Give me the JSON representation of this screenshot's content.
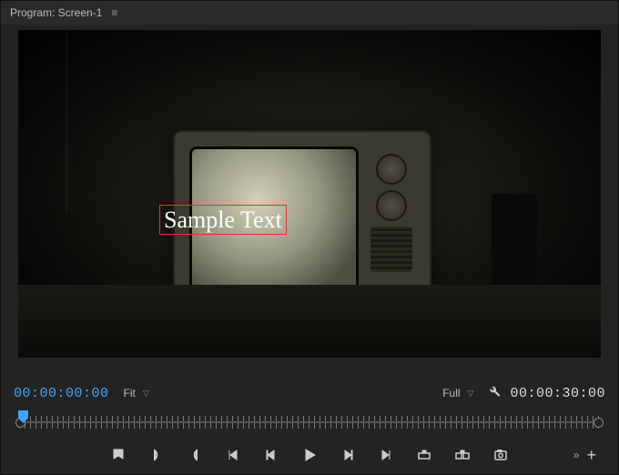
{
  "header": {
    "title": "Program: Screen-1"
  },
  "canvas": {
    "overlay_text": "Sample Text"
  },
  "controls": {
    "current_time": "00:00:00:00",
    "zoom_label": "Fit",
    "quality_label": "Full",
    "duration": "00:00:30:00"
  },
  "icons": {
    "menu": "≡",
    "wrench": "🔧",
    "chevrons": "»",
    "plus": "+"
  }
}
